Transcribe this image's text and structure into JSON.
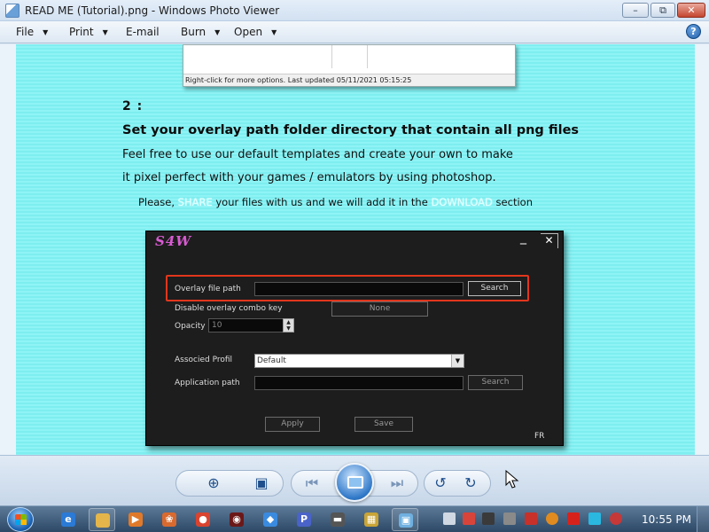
{
  "window": {
    "title": "READ ME (Tutorial).png - Windows Photo Viewer",
    "minimize_glyph": "–",
    "maximize_glyph": "⧉",
    "close_glyph": "✕"
  },
  "menu": {
    "items": [
      {
        "label": "File"
      },
      {
        "label": "Print"
      },
      {
        "label": "E-mail"
      },
      {
        "label": "Burn"
      },
      {
        "label": "Open"
      }
    ],
    "caret": "▼",
    "help_glyph": "?"
  },
  "image": {
    "top_status": "Right-click for more options.  Last updated 05/11/2021 05:15:25",
    "step_number": "2 :",
    "heading": "Set your overlay path folder directory that contain all png files",
    "line1": "Feel free to use our default templates and create your own to make",
    "line2": "it pixel perfect with your games / emulators by using photoshop.",
    "share_prefix": "Please, ",
    "share_word": "SHARE",
    "share_mid": " your files with us and we will add it in the ",
    "download_word": "DOWNLOAD",
    "share_suffix": " section",
    "app": {
      "logo": "S4W",
      "close_glyph": "✕",
      "overlay_label": "Overlay file path",
      "search_button": "Search",
      "combo_key_label": "Disable overlay combo key",
      "combo_key_value": "None",
      "opacity_label": "Opacity",
      "opacity_value": "10",
      "profile_label": "Associed Profil",
      "profile_value": "Default",
      "app_path_label": "Application path",
      "search_button2": "Search",
      "apply_button": "Apply",
      "save_button": "Save",
      "lang": "FR"
    }
  },
  "controls": {
    "zoom_glyph": "⊕",
    "fit_glyph": "▣",
    "prev_glyph": "⏮",
    "next_glyph": "⏭",
    "rotate_ccw_glyph": "↺",
    "rotate_cw_glyph": "↻"
  },
  "taskbar": {
    "clock": "10:55 PM",
    "pinned": [
      {
        "name": "internet-explorer-icon",
        "glyph": "e",
        "color": "#2a7ad6"
      },
      {
        "name": "file-explorer-icon",
        "glyph": "",
        "color": "#e3b54a"
      },
      {
        "name": "media-player-icon",
        "glyph": "▶",
        "color": "#e07a2a"
      },
      {
        "name": "paint-icon",
        "glyph": "❀",
        "color": "#d96a2f"
      },
      {
        "name": "chrome-icon",
        "glyph": "●",
        "color": "#d9432f"
      },
      {
        "name": "obs-icon",
        "glyph": "◉",
        "color": "#6b1818"
      },
      {
        "name": "shield-icon",
        "glyph": "◆",
        "color": "#3a8be0"
      },
      {
        "name": "p-app-icon",
        "glyph": "P",
        "color": "#4a63c9"
      },
      {
        "name": "reader-icon",
        "glyph": "▬",
        "color": "#555555"
      },
      {
        "name": "control-panel-icon",
        "glyph": "▦",
        "color": "#c9a436"
      },
      {
        "name": "photo-viewer-icon",
        "glyph": "▣",
        "color": "#6fb0e0"
      }
    ]
  }
}
